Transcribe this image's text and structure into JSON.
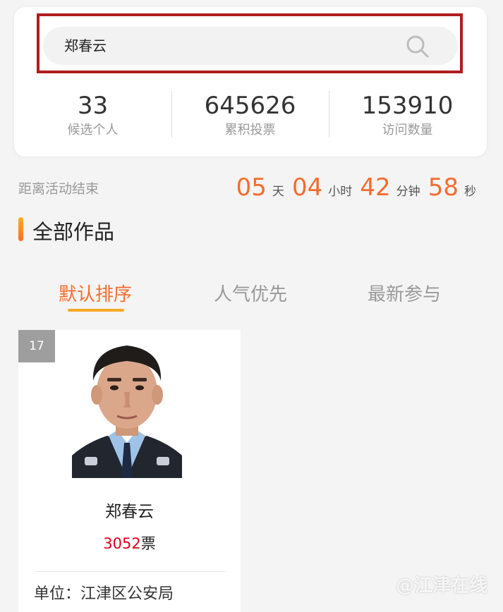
{
  "search": {
    "query": "郑春云"
  },
  "stats": [
    {
      "value": "33",
      "label": "候选个人"
    },
    {
      "value": "645626",
      "label": "累积投票"
    },
    {
      "value": "153910",
      "label": "访问数量"
    }
  ],
  "countdown": {
    "label": "距离活动结束",
    "days": "05",
    "days_unit": "天",
    "hours": "04",
    "hours_unit": "小时",
    "minutes": "42",
    "minutes_unit": "分钟",
    "seconds": "58",
    "seconds_unit": "秒"
  },
  "section": {
    "title": "全部作品"
  },
  "tabs": [
    {
      "label": "默认排序",
      "active": true
    },
    {
      "label": "人气优先",
      "active": false
    },
    {
      "label": "最新参与",
      "active": false
    }
  ],
  "candidate": {
    "rank": "17",
    "name": "郑春云",
    "votes": "3052",
    "votes_suffix": "票",
    "unit_label": "单位：江津区公安局"
  },
  "watermark": "@江津在线",
  "colors": {
    "accent": "#f56c2d",
    "vote_red": "#e1001a",
    "highlight_frame": "#b11d1d"
  }
}
